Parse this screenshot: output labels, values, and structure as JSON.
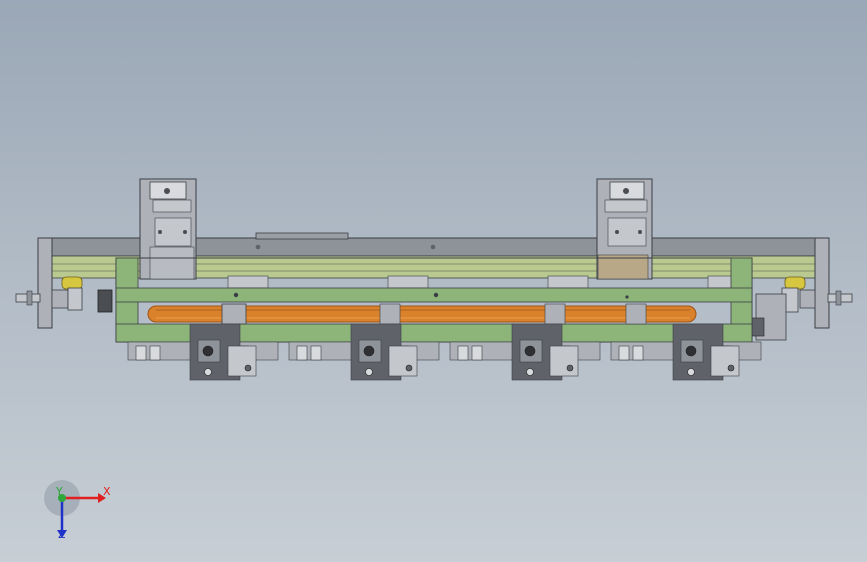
{
  "viewport": {
    "background_top": "#9aa7b6",
    "background_bottom": "#c7ced5"
  },
  "model": {
    "colors": {
      "frame_green": "#8db57a",
      "frame_green_dark": "#5f8a55",
      "beam_grey": "#8e9299",
      "rail_green": "#b9c98f",
      "belt_orange": "#d9822b",
      "belt_orange_dark": "#9e5418",
      "steel": "#aeb2b8",
      "steel_dark": "#5f6369",
      "yellow_part": "#d6c640"
    },
    "motor_count": 2,
    "gripper_station_count": 4
  },
  "triad": {
    "x_label": "X",
    "y_label": "Y",
    "z_label": "Z",
    "x_color": "#e0201e",
    "y_color": "#2ea63a",
    "z_color": "#1e32c8"
  }
}
